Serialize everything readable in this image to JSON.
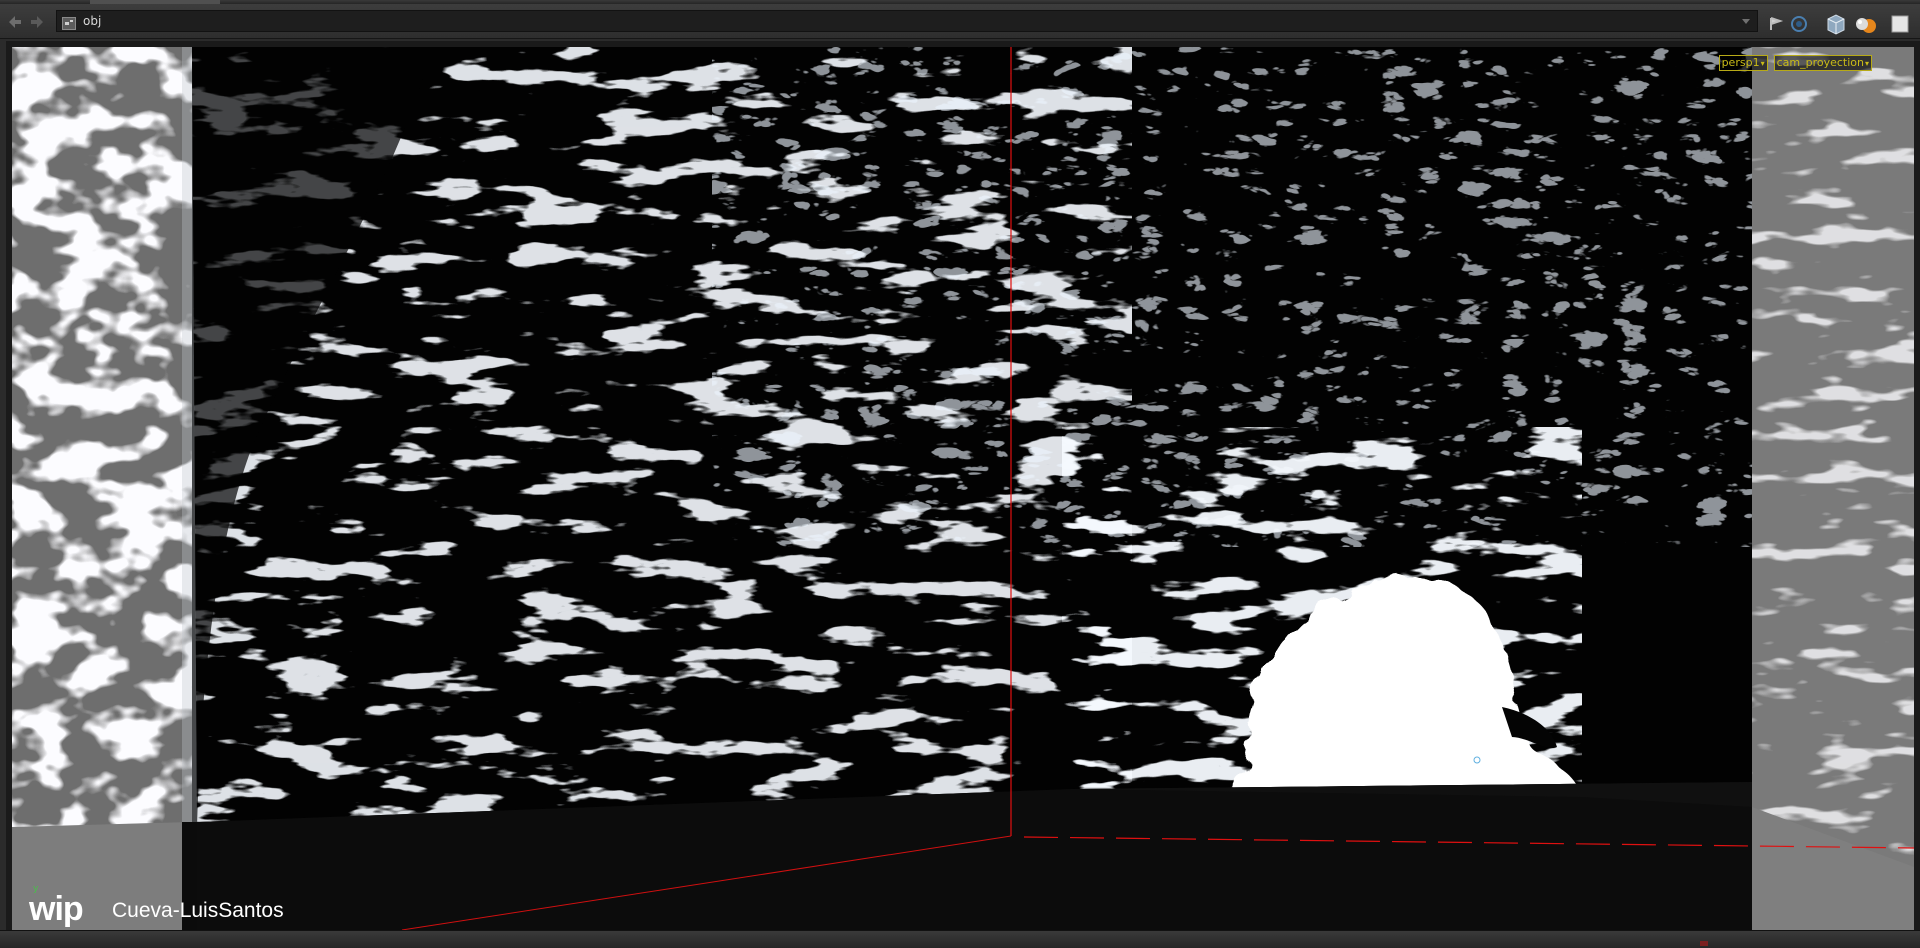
{
  "toolbar": {
    "back_icon": "back-arrow-icon",
    "forward_icon": "forward-arrow-icon",
    "path_value": "obj",
    "right_icons": [
      "pin-icon",
      "scope-icon",
      "display-options-icon",
      "render-icon",
      "maximize-icon"
    ]
  },
  "viewport": {
    "camera_menus": [
      "persp1",
      "cam_proyection"
    ],
    "watermark": "wip",
    "scene_name": "Cueva-LuisSantos",
    "axis_label": "y"
  },
  "colors": {
    "camera_menu": "#c9bb18",
    "guide_line": "#e01010",
    "backdrop": "#7d7d7d",
    "cave_light": "#ffffff"
  }
}
